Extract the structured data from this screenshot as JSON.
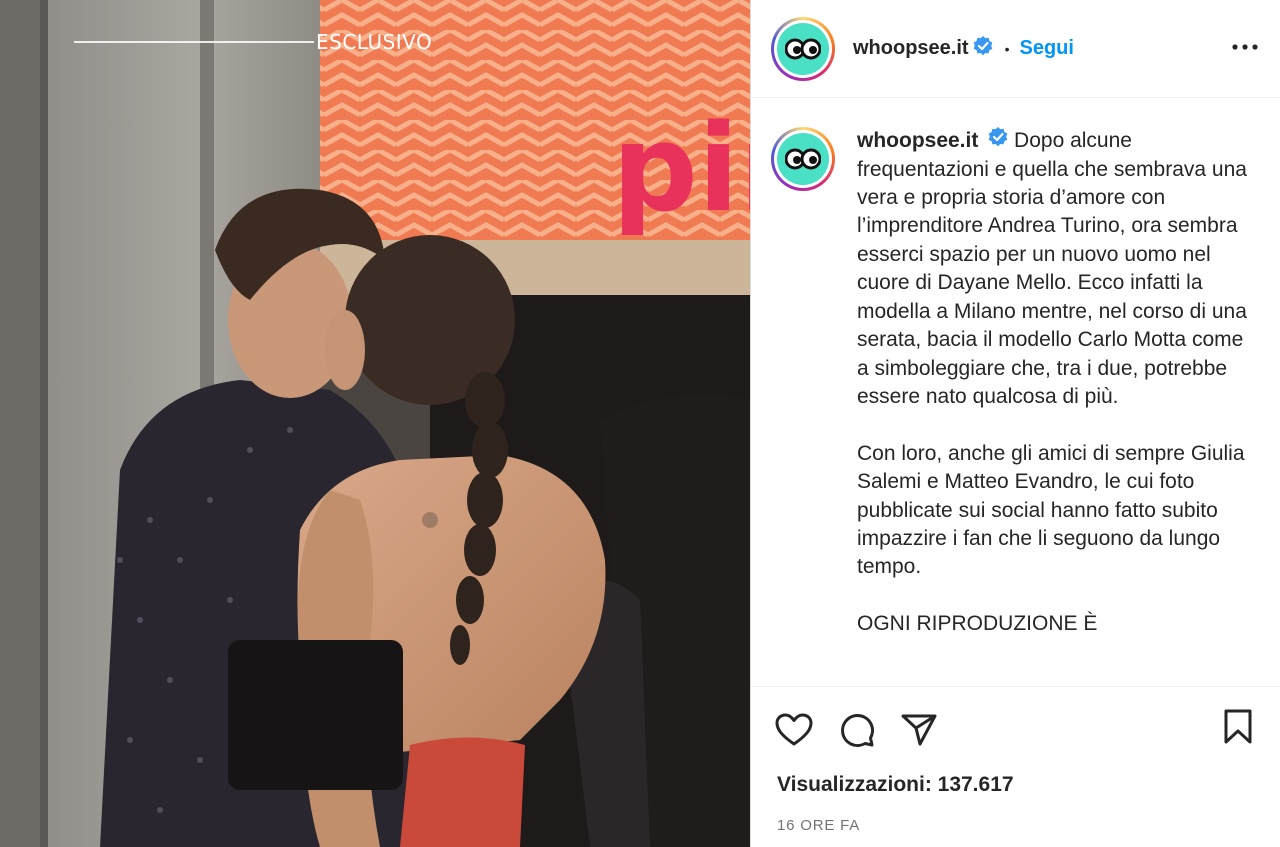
{
  "media": {
    "badge": "ESCLUSIVO",
    "sign_text": "pin"
  },
  "header": {
    "username": "whoopsee.it",
    "separator": "•",
    "follow_label": "Segui",
    "avatar_icon": "googly-eyes-icon",
    "verified_icon": "verified-badge-icon",
    "more_icon": "more-options-icon"
  },
  "caption": {
    "username": "whoopsee.it",
    "paragraphs": [
      "Dopo alcune frequentazioni e quella che sembrava una vera e propria storia d’amore con l’imprenditore Andrea Turino, ora sembra esserci spazio per un nuovo uomo nel cuore di Dayane Mello. Ecco infatti la modella a Milano mentre, nel corso di una serata, bacia il modello Carlo Motta come a simboleggiare che, tra i due, potrebbe essere nato qualcosa di più.",
      "Con loro, anche gli amici di sempre Giulia Salemi e Matteo Evandro, le cui foto pubblicate sui social hanno fatto subito impazzire i fan che li seguono da lungo tempo.",
      "OGNI RIPRODUZIONE È"
    ]
  },
  "actions": {
    "like_icon": "heart-icon",
    "comment_icon": "comment-icon",
    "share_icon": "send-icon",
    "save_icon": "bookmark-icon"
  },
  "stats": {
    "views": "Visualizzazioni: 137.617",
    "time": "16 ORE FA"
  },
  "colors": {
    "accent": "#0095f6",
    "avatar_bg": "#49e0c6",
    "text": "#262626",
    "muted": "#737373"
  }
}
